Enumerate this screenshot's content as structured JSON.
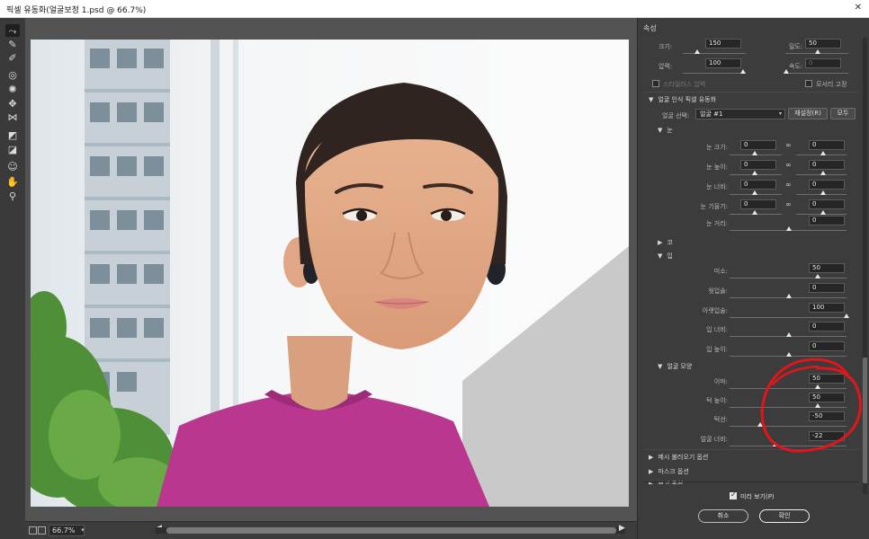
{
  "window": {
    "title": "픽셀 유동화(얼굴보정 1.psd @ 66.7%)"
  },
  "toolbar": {
    "tools": [
      {
        "name": "forward-warp-tool-icon",
        "glyph": "⤳"
      },
      {
        "name": "reconstruct-tool-icon",
        "glyph": "✎"
      },
      {
        "name": "smooth-tool-icon",
        "glyph": "✐"
      },
      {
        "name": "twirl-tool-icon",
        "glyph": "◎"
      },
      {
        "name": "pucker-tool-icon",
        "glyph": "✺"
      },
      {
        "name": "bloat-tool-icon",
        "glyph": "✥"
      },
      {
        "name": "push-left-tool-icon",
        "glyph": "⋈"
      },
      {
        "name": "freeze-mask-tool-icon",
        "glyph": "◩"
      },
      {
        "name": "thaw-mask-tool-icon",
        "glyph": "◪"
      },
      {
        "name": "face-tool-icon",
        "glyph": "☺"
      },
      {
        "name": "hand-tool-icon",
        "glyph": "✋"
      },
      {
        "name": "zoom-tool-icon",
        "glyph": "⚲"
      }
    ]
  },
  "status": {
    "zoom": "66.7%"
  },
  "panel": {
    "header": "속성",
    "brush": {
      "size_label": "크기:",
      "size": "150",
      "density_label": "밀도:",
      "density": "50",
      "pressure_label": "압력:",
      "pressure": "100",
      "rate_label": "속도:",
      "rate": "0",
      "stylus_label": "스타일러스 압력",
      "pin_edges_label": "모서리 고정"
    },
    "face_aware": {
      "section_label": "얼굴 인식 픽셀 유동화",
      "select_face_label": "얼굴 선택:",
      "select_face_value": "얼굴 #1",
      "reset_button": "재설정(R)",
      "all_button": "모두",
      "eyes": {
        "label": "눈",
        "rows": [
          {
            "label": "눈 크기:",
            "left": "0",
            "right": "0"
          },
          {
            "label": "눈 높이:",
            "left": "0",
            "right": "0"
          },
          {
            "label": "눈 너비:",
            "left": "0",
            "right": "0"
          },
          {
            "label": "눈 기울기:",
            "left": "0",
            "right": "0"
          }
        ],
        "distance_label": "눈 거리:",
        "distance": "0"
      },
      "nose": {
        "label": "코"
      },
      "mouth": {
        "label": "입",
        "rows": [
          {
            "label": "미소:",
            "value": "50"
          },
          {
            "label": "윗입술:",
            "value": "0"
          },
          {
            "label": "아랫입술:",
            "value": "100"
          },
          {
            "label": "입 너비:",
            "value": "0"
          },
          {
            "label": "입 높이:",
            "value": "0"
          }
        ]
      },
      "face_shape": {
        "label": "얼굴 모양",
        "rows": [
          {
            "label": "이마:",
            "value": "50"
          },
          {
            "label": "턱 높이:",
            "value": "50"
          },
          {
            "label": "턱선:",
            "value": "-50"
          },
          {
            "label": "얼굴 너비:",
            "value": "-22"
          }
        ]
      }
    },
    "mesh_label": "메시 불러오기 옵션",
    "mask_label": "마스크 옵션",
    "view_label": "보기 옵션",
    "preview_label": "미리 보기(P)",
    "cancel_button": "취소",
    "ok_button": "확인"
  },
  "colors": {
    "annotation": "#e3151a",
    "shirt": "#b9378f"
  }
}
